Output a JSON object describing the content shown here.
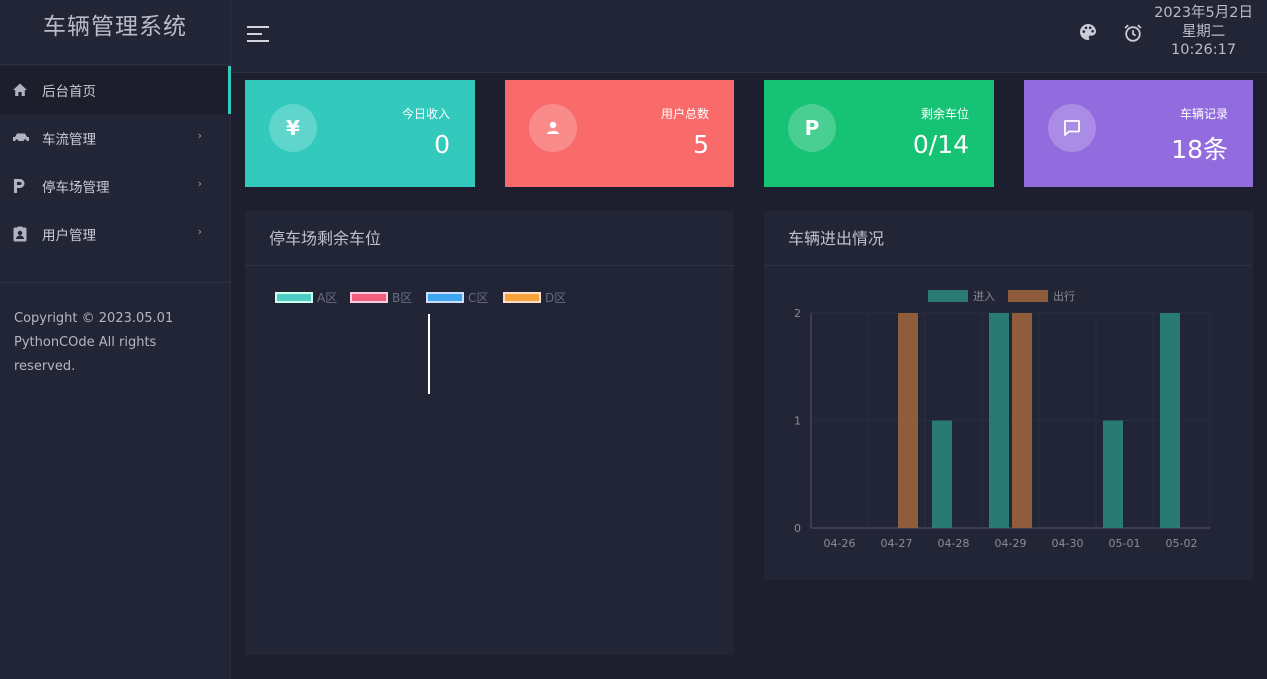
{
  "app": {
    "title": "车辆管理系统"
  },
  "sidebar": {
    "items": [
      {
        "label": "后台首页",
        "icon": "home-icon",
        "active": true
      },
      {
        "label": "车流管理",
        "icon": "car-icon",
        "has_submenu": true
      },
      {
        "label": "停车场管理",
        "icon": "parking-icon",
        "has_submenu": true
      },
      {
        "label": "用户管理",
        "icon": "user-badge-icon",
        "has_submenu": true
      }
    ],
    "copyright_line1": "Copyright © 2023.05.01",
    "copyright_line2": "PythonCOde All rights",
    "copyright_line3": "reserved."
  },
  "header": {
    "date": "2023年5月2日",
    "weekday": "星期二",
    "time": "10:26:17"
  },
  "stats": [
    {
      "label": "今日收入",
      "value": "0",
      "icon_glyph": "¥",
      "color": "#33c9bd"
    },
    {
      "label": "用户总数",
      "value": "5",
      "icon": "user-icon",
      "color": "#f96b6b"
    },
    {
      "label": "剩余车位",
      "value": "0/14",
      "icon_glyph": "P",
      "color": "#16c274"
    },
    {
      "label": "车辆记录",
      "value": "18条",
      "icon": "message-icon",
      "color": "#926bde"
    }
  ],
  "parking_panel": {
    "title": "停车场剩余车位",
    "legend": [
      {
        "name": "A区",
        "color": "#4ecdc4"
      },
      {
        "name": "B区",
        "color": "#f25c7d"
      },
      {
        "name": "C区",
        "color": "#3ea5f0"
      },
      {
        "name": "D区",
        "color": "#f8a33a"
      }
    ]
  },
  "traffic_panel": {
    "title": "车辆进出情况"
  },
  "chart_data": {
    "type": "bar",
    "categories": [
      "04-26",
      "04-27",
      "04-28",
      "04-29",
      "04-30",
      "05-01",
      "05-02"
    ],
    "series": [
      {
        "name": "进入",
        "values": [
          0,
          0,
          1,
          2,
          0,
          1,
          2
        ],
        "color": "#2a7a74"
      },
      {
        "name": "出行",
        "values": [
          0,
          2,
          0,
          2,
          0,
          0,
          0
        ],
        "color": "#8f5d3b"
      }
    ],
    "ylim": [
      0,
      2
    ],
    "yticks": [
      "0",
      "1",
      "2"
    ],
    "legend_position": "top-center",
    "grid": true
  }
}
